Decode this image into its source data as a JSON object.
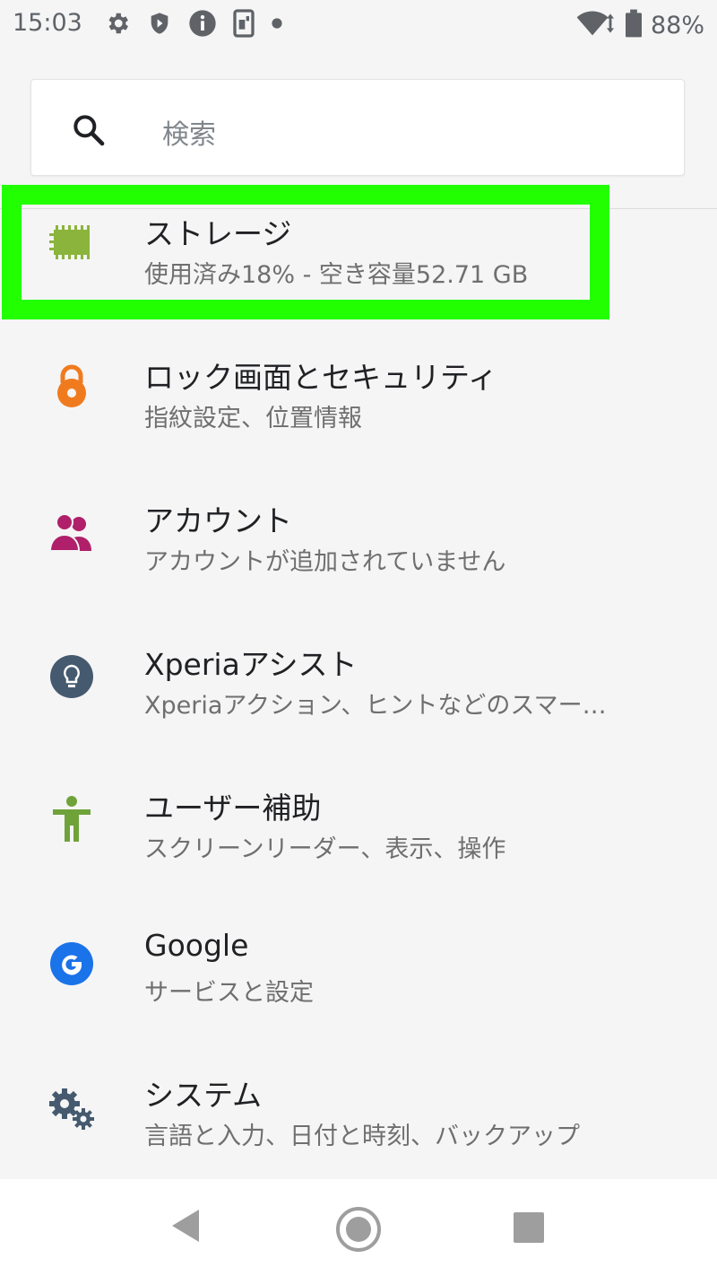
{
  "status_bar": {
    "time": "15:03",
    "battery": "88%",
    "icons_left": [
      "gear-icon",
      "shield-icon",
      "info-icon",
      "sim-icon",
      "dot-icon"
    ],
    "icons_right": [
      "wifi-icon",
      "battery-icon"
    ]
  },
  "search": {
    "placeholder": "検索"
  },
  "settings_items": [
    {
      "icon": "storage-icon",
      "title": "ストレージ",
      "subtitle": "使用済み18% - 空き容量52.71 GB",
      "icon_color": "#8ab43c"
    },
    {
      "icon": "lock-icon",
      "title": "ロック画面とセキュリティ",
      "subtitle": "指紋設定、位置情報",
      "icon_color": "#f07b1e"
    },
    {
      "icon": "accounts-icon",
      "title": "アカウント",
      "subtitle": "アカウントが追加されていません",
      "icon_color": "#b0206a"
    },
    {
      "icon": "lightbulb-icon",
      "title": "Xperiaアシスト",
      "subtitle": "Xperiaアクション、ヒントなどのスマー…",
      "icon_color": "#455a6e"
    },
    {
      "icon": "accessibility-icon",
      "title": "ユーザー補助",
      "subtitle": "スクリーンリーダー、表示、操作",
      "icon_color": "#6fa33a"
    },
    {
      "icon": "google-icon",
      "title": "Google",
      "subtitle": "サービスと設定",
      "icon_color": "#1a73e8"
    },
    {
      "icon": "system-gears-icon",
      "title": "システム",
      "subtitle": "言語と入力、日付と時刻、バックアップ",
      "icon_color": "#455a6e"
    }
  ],
  "highlight_color": "#22ff00",
  "nav_bar": {
    "buttons": [
      "back-icon",
      "home-icon",
      "recents-icon"
    ]
  }
}
